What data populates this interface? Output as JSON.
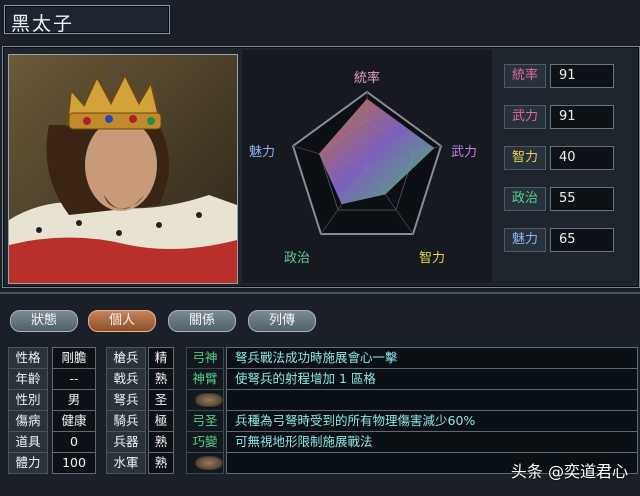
{
  "title": "黑太子",
  "radar": {
    "labels": {
      "top": "統率",
      "right": "武力",
      "bottom_right": "智力",
      "bottom_left": "政治",
      "left": "魅力"
    }
  },
  "stats": [
    {
      "label": "統率",
      "value": "91",
      "color": "#e26a9c"
    },
    {
      "label": "武力",
      "value": "91",
      "color": "#e26a9c"
    },
    {
      "label": "智力",
      "value": "40",
      "color": "#e8d24a"
    },
    {
      "label": "政治",
      "value": "55",
      "color": "#56d08c"
    },
    {
      "label": "魅力",
      "value": "65",
      "color": "#8cb4f0"
    }
  ],
  "tabs": [
    "狀態",
    "個人",
    "關係",
    "列傳"
  ],
  "active_tab": "個人",
  "attributes": [
    {
      "label": "性格",
      "value": "剛膽"
    },
    {
      "label": "年齡",
      "value": "--"
    },
    {
      "label": "性別",
      "value": "男"
    },
    {
      "label": "傷病",
      "value": "健康"
    },
    {
      "label": "道具",
      "value": "0"
    },
    {
      "label": "體力",
      "value": "100"
    }
  ],
  "troops": [
    {
      "label": "槍兵",
      "value": "精"
    },
    {
      "label": "戟兵",
      "value": "熟"
    },
    {
      "label": "弩兵",
      "value": "圣"
    },
    {
      "label": "騎兵",
      "value": "極"
    },
    {
      "label": "兵器",
      "value": "熟"
    },
    {
      "label": "水軍",
      "value": "熟"
    }
  ],
  "skills": [
    {
      "name": "弓神",
      "desc": "弩兵戰法成功時施展會心一擊"
    },
    {
      "name": "神臂",
      "desc": "使弩兵的射程增加 1 區格"
    },
    {
      "name": "",
      "desc": ""
    },
    {
      "name": "弓圣",
      "desc": "兵種為弓弩時受到的所有物理傷害減少60%"
    },
    {
      "name": "巧變",
      "desc": "可無視地形限制施展戰法"
    },
    {
      "name": "",
      "desc": ""
    }
  ],
  "watermark": "头条 @奕道君心"
}
